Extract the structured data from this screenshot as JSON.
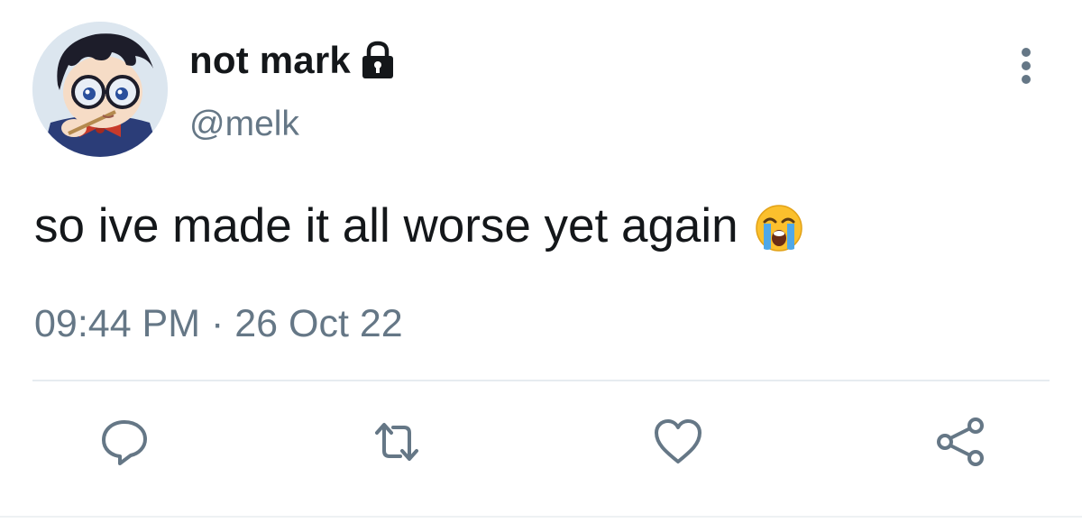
{
  "user": {
    "display_name": "not mark",
    "handle": "@melk",
    "avatar_icon": "anime-character-avatar",
    "protected_icon": "lock-icon"
  },
  "tweet": {
    "text": "so ive made it all worse yet again",
    "emoji": "loudly-crying-face-emoji",
    "timestamp": "09:44 PM · 26 Oct 22"
  },
  "actions": [
    {
      "name": "reply",
      "icon": "reply-icon"
    },
    {
      "name": "retweet",
      "icon": "retweet-icon"
    },
    {
      "name": "like",
      "icon": "heart-icon"
    },
    {
      "name": "share",
      "icon": "share-icon"
    }
  ],
  "colors": {
    "text_primary": "#14171a",
    "text_secondary": "#657786",
    "icon": "#657786",
    "divider": "#e6ecf0"
  }
}
